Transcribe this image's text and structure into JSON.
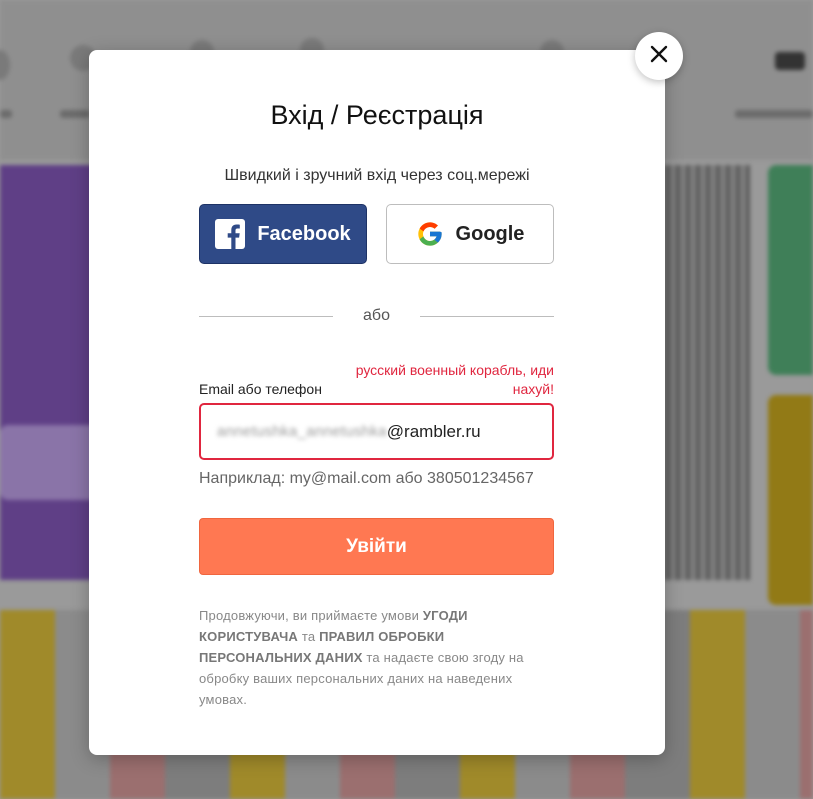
{
  "modal": {
    "title": "Вхід / Реєстрація",
    "subtitle": "Швидкий і зручний вхід через соц.мережі",
    "social": {
      "facebook_label": "Facebook",
      "google_label": "Google"
    },
    "divider_text": "або",
    "email_field": {
      "label": "Email або телефон",
      "error": "русский военный корабль, иди нахуй!",
      "value_blurred_part": "annetushka_annetushka",
      "value_domain": "@rambler.ru",
      "hint": "Наприклад: my@mail.com або 380501234567"
    },
    "submit_label": "Увійти",
    "terms": {
      "part1": "Продовжуючи, ви приймаєте умови ",
      "link1": "УГОДИ КОРИСТУВАЧА",
      "part2": " та ",
      "link2": "ПРАВИЛ ОБРОБКИ ПЕРСОНАЛЬНИХ ДАНИХ",
      "part3": " та надаєте свою згоду на обробку ваших персональних даних на наведених умовах."
    },
    "close_icon": "close-icon"
  },
  "colors": {
    "facebook": "#2f4a87",
    "submit": "#ff7852",
    "error": "#e0263f"
  }
}
